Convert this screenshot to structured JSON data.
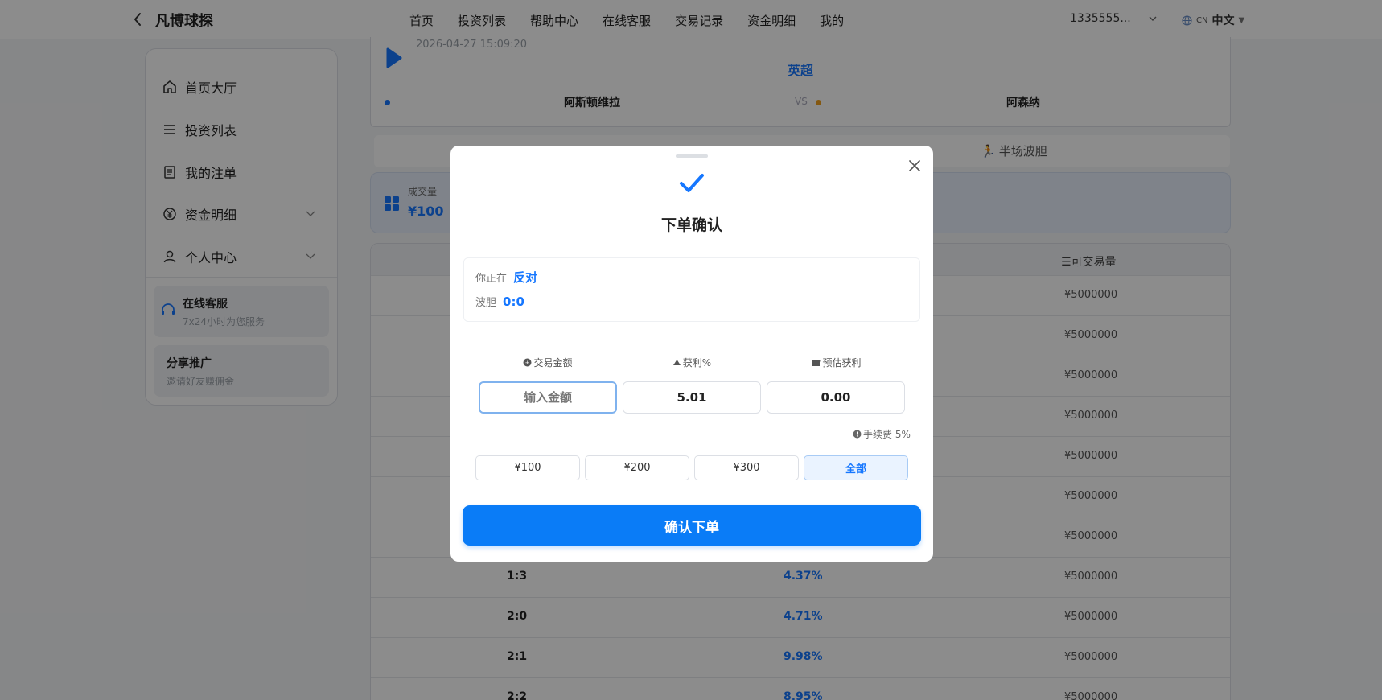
{
  "header": {
    "app_title": "凡博球探",
    "nav": [
      "首页",
      "投资列表",
      "帮助中心",
      "在线客服",
      "交易记录",
      "资金明细",
      "我的"
    ],
    "account": "1335555...",
    "lang_region": "CN",
    "lang_label": "中文"
  },
  "sidebar": {
    "items": [
      {
        "label": "首页大厅",
        "icon": "home-icon"
      },
      {
        "label": "投资列表",
        "icon": "list-icon"
      },
      {
        "label": "我的注单",
        "icon": "document-icon"
      },
      {
        "label": "资金明细",
        "icon": "yuan-icon"
      },
      {
        "label": "个人中心",
        "icon": "user-icon"
      }
    ],
    "support": {
      "title": "在线客服",
      "subtitle": "7x24小时为您服务"
    },
    "share": {
      "title": "分享推广",
      "subtitle": "邀请好友赚佣金"
    }
  },
  "match": {
    "time": "2026-04-27 15:09:20",
    "league": "英超",
    "home": "阿斯顿维拉",
    "away": "阿森纳",
    "vs": "VS"
  },
  "tabs": {
    "second": "半场波胆"
  },
  "stats": {
    "label": "成交量",
    "value": "¥100"
  },
  "table": {
    "header_avail": "可交易量",
    "rows": [
      {
        "score": "",
        "odds": "",
        "avail": "¥5000000"
      },
      {
        "score": "",
        "odds": "",
        "avail": "¥5000000"
      },
      {
        "score": "",
        "odds": "",
        "avail": "¥5000000"
      },
      {
        "score": "",
        "odds": "",
        "avail": "¥5000000"
      },
      {
        "score": "",
        "odds": "",
        "avail": "¥5000000"
      },
      {
        "score": "",
        "odds": "",
        "avail": "¥5000000"
      },
      {
        "score": "",
        "odds": "",
        "avail": "¥5000000"
      },
      {
        "score": "1:3",
        "odds": "4.37%",
        "avail": "¥5000000"
      },
      {
        "score": "2:0",
        "odds": "4.71%",
        "avail": "¥5000000"
      },
      {
        "score": "2:1",
        "odds": "9.98%",
        "avail": "¥5000000"
      },
      {
        "score": "2:2",
        "odds": "8.95%",
        "avail": "¥5000000"
      }
    ]
  },
  "modal": {
    "title": "下单确认",
    "position_label": "你正在",
    "position_value": "反对",
    "market_label": "波胆",
    "market_value": "0:0",
    "amount_label": "交易金额",
    "amount_placeholder": "输入金额",
    "profit_rate_label": "获利%",
    "profit_rate_value": "5.01",
    "est_profit_label": "预估获利",
    "est_profit_value": "0.00",
    "fee_label": "手续费 5%",
    "quick_amounts": [
      "¥100",
      "¥200",
      "¥300",
      "全部"
    ],
    "confirm_label": "确认下单"
  },
  "colors": {
    "accent": "#1677ff",
    "primary_button": "#0a7cf7"
  }
}
